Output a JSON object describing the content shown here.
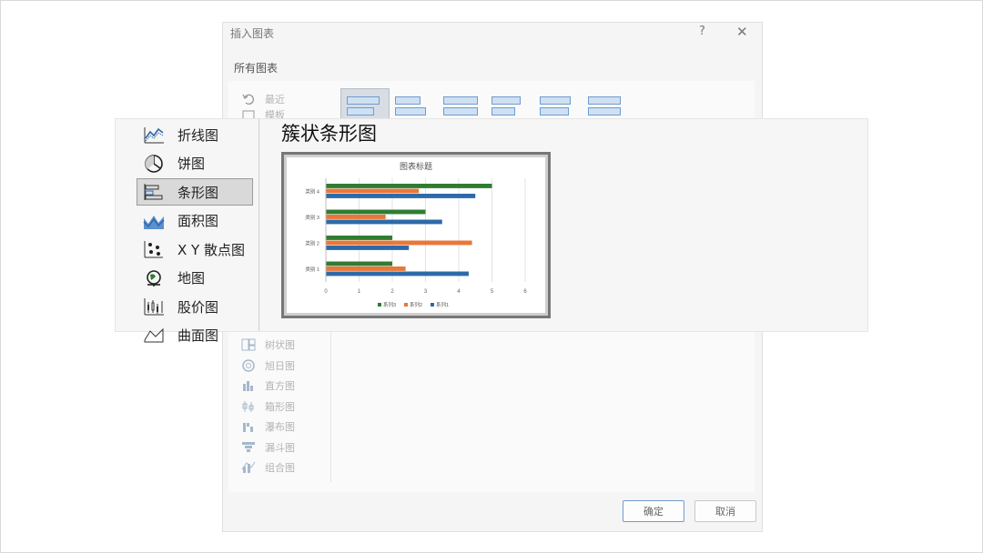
{
  "dialog": {
    "title": "插入图表",
    "help": "?",
    "close": "✕",
    "tab": "所有图表",
    "recent_label": "最近",
    "cut_label": "模板",
    "lower_categories": [
      {
        "label": "树状图",
        "icon": "treemap-icon"
      },
      {
        "label": "旭日图",
        "icon": "sunburst-icon"
      },
      {
        "label": "直方图",
        "icon": "histogram-icon"
      },
      {
        "label": "箱形图",
        "icon": "boxplot-icon"
      },
      {
        "label": "瀑布图",
        "icon": "waterfall-icon"
      },
      {
        "label": "漏斗图",
        "icon": "funnel-icon"
      },
      {
        "label": "组合图",
        "icon": "combo-icon"
      }
    ],
    "ok_label": "确定",
    "cancel_label": "取消"
  },
  "overlay": {
    "categories": [
      {
        "label": "折线图",
        "icon": "line-chart-icon"
      },
      {
        "label": "饼图",
        "icon": "pie-chart-icon"
      },
      {
        "label": "条形图",
        "icon": "bar-chart-icon",
        "selected": true
      },
      {
        "label": "面积图",
        "icon": "area-chart-icon"
      },
      {
        "label": "X Y 散点图",
        "icon": "scatter-chart-icon"
      },
      {
        "label": "地图",
        "icon": "map-globe-icon"
      },
      {
        "label": "股价图",
        "icon": "stock-chart-icon"
      },
      {
        "label": "曲面图",
        "icon": "surface-chart-icon"
      }
    ],
    "heading": "簇状条形图"
  },
  "colors": {
    "series1": "#2e6aa8",
    "series2": "#e8773a",
    "series3": "#2f7d32"
  },
  "chart_data": {
    "type": "bar",
    "orientation": "horizontal",
    "title": "图表标题",
    "categories": [
      "类别 1",
      "类别 2",
      "类别 3",
      "类别 4"
    ],
    "series": [
      {
        "name": "系列1",
        "values": [
          4.3,
          2.5,
          3.5,
          4.5
        ]
      },
      {
        "name": "系列2",
        "values": [
          2.4,
          4.4,
          1.8,
          2.8
        ]
      },
      {
        "name": "系列3",
        "values": [
          2.0,
          2.0,
          3.0,
          5.0
        ]
      }
    ],
    "xlim": [
      0,
      6
    ],
    "ticks": [
      "0",
      "1",
      "2",
      "3",
      "4",
      "5",
      "6"
    ],
    "legend": [
      "系列3",
      "系列2",
      "系列1"
    ],
    "legend_position": "bottom",
    "grid": true
  }
}
